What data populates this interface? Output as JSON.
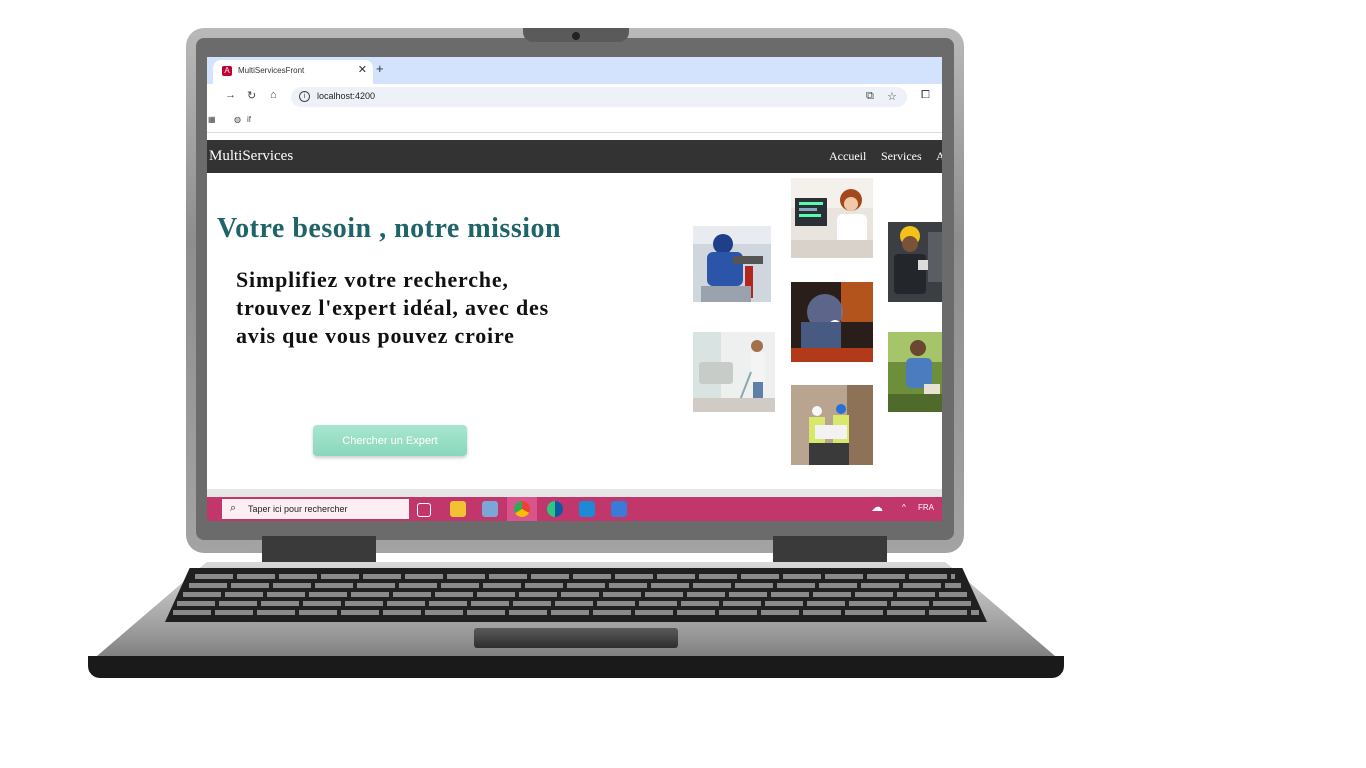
{
  "browser": {
    "tab_title": "MultiServicesFront",
    "tab_close": "✕",
    "new_tab": "+",
    "url": "localhost:4200",
    "bookmark_label": "if",
    "accent": "#d3e3fd"
  },
  "site": {
    "brand": "MultiServices",
    "nav": [
      "Accueil",
      "Services",
      "A"
    ],
    "hero_title": "Votre besoin , notre mission",
    "hero_sub": "Simplifiez votre recherche, trouvez l'expert idéal, avec des avis que vous pouvez croire",
    "cta_label": "Chercher un Expert",
    "title_color": "#1f6468",
    "cta_color": "#a8e6cf"
  },
  "photos": [
    "plumber",
    "developer",
    "mechanic",
    "welder",
    "cleaner",
    "gardener",
    "engineers"
  ],
  "taskbar": {
    "search_placeholder": "Taper ici pour rechercher",
    "language": "FRA",
    "color": "#c2376b"
  }
}
